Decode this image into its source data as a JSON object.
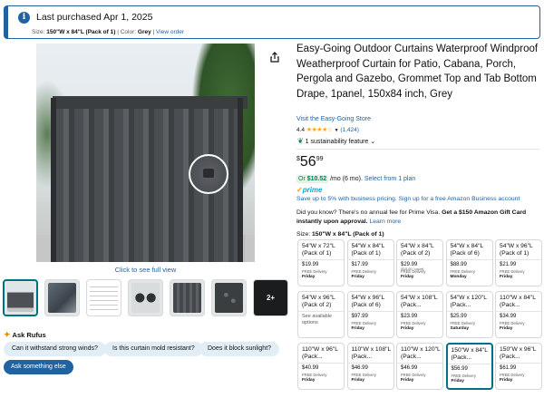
{
  "banner": {
    "title": "Last purchased Apr 1, 2025",
    "size_label": "Size:",
    "size_value": "150\"W x 84\"L (Pack of 1)",
    "color_label": "Color:",
    "color_value": "Grey",
    "view_order": "View order"
  },
  "gallery": {
    "full_view_link": "Click to see full view",
    "more_thumbs_label": "2+"
  },
  "rufus": {
    "label": "Ask Rufus",
    "chips": [
      "Can it withstand strong winds?",
      "Is this curtain mold resistant?",
      "Does it block sunlight?"
    ],
    "ask_button": "Ask something else"
  },
  "product": {
    "title": "Easy-Going Outdoor Curtains Waterproof Windproof Weatherproof Curtain for Patio, Cabana, Porch, Pergola and Gazebo, Grommet Top and Tab Bottom Drape, 1panel, 150x84 inch, Grey",
    "store_link": "Visit the Easy-Going Store",
    "rating": "4.4",
    "stars": "★★★★☆",
    "rating_count": "(1,424)",
    "sustainability": "1 sustainability feature",
    "price_symbol": "$",
    "price_whole": "56",
    "price_fraction": "99",
    "installment_or": "Or",
    "installment_amount": "$10.52",
    "installment_terms": "/mo (6 mo).",
    "installment_link": "Select from 1 plan",
    "prime_label": "prime",
    "business_save": "Save up to 5% with business pricing. Sign up for a free Amazon Business account",
    "promo_text": "Did you know? There's no annual fee for Prime Visa.",
    "promo_bold": "Get a $150 Amazon Gift Card instantly upon approval.",
    "promo_link": "Learn more",
    "size_label": "Size:",
    "size_selected": "150\"W x 84\"L (Pack of 1)"
  },
  "size_options": [
    {
      "name": "54\"W x 72\"L (Pack of 1)",
      "price": "$19.99",
      "delivery": "FREE Delivery",
      "day": "Friday"
    },
    {
      "name": "54\"W x 84\"L (Pack of 1)",
      "price": "$17.99",
      "delivery": "FREE Delivery",
      "day": "Friday"
    },
    {
      "name": "54\"W x 84\"L (Pack of 2)",
      "price": "$29.99",
      "note": "($15.00 / count)",
      "delivery": "FREE Delivery",
      "day": "Friday"
    },
    {
      "name": "54\"W x 84\"L (Pack of 6)",
      "price": "$88.99",
      "delivery": "FREE Delivery",
      "day": "Monday"
    },
    {
      "name": "54\"W x 96\"L (Pack of 1)",
      "price": "$21.99",
      "delivery": "FREE Delivery",
      "day": "Friday"
    },
    {
      "name": "54\"W x 96\"L (Pack of 2)",
      "availability": "See available options"
    },
    {
      "name": "54\"W x 96\"L (Pack of 6)",
      "price": "$97.99",
      "delivery": "FREE Delivery",
      "day": "Friday"
    },
    {
      "name": "54\"W x 108\"L (Pack...",
      "price": "$23.99",
      "delivery": "FREE Delivery",
      "day": "Friday"
    },
    {
      "name": "54\"W x 120\"L (Pack...",
      "price": "$25.99",
      "delivery": "FREE Delivery",
      "day": "Saturday"
    },
    {
      "name": "110\"W x 84\"L (Pack...",
      "price": "$34.99",
      "delivery": "FREE Delivery",
      "day": "Friday"
    },
    {
      "name": "110\"W x 96\"L (Pack...",
      "price": "$40.99",
      "delivery": "FREE Delivery",
      "day": "Friday"
    },
    {
      "name": "110\"W x 108\"L (Pack...",
      "price": "$46.99",
      "delivery": "FREE Delivery",
      "day": "Friday"
    },
    {
      "name": "110\"W x 120\"L (Pack...",
      "price": "$46.99",
      "delivery": "FREE Delivery",
      "day": "Friday"
    },
    {
      "name": "150\"W x 84\"L (Pack...",
      "price": "$56.99",
      "delivery": "FREE Delivery",
      "day": "Friday",
      "selected": true
    },
    {
      "name": "150\"W x 96\"L (Pack...",
      "price": "$61.99",
      "delivery": "FREE Delivery",
      "day": "Friday"
    }
  ],
  "colors": {
    "link": "#2162a1",
    "selected_border": "#007185",
    "star": "#ffa41c",
    "prime": "#00a8e1"
  }
}
